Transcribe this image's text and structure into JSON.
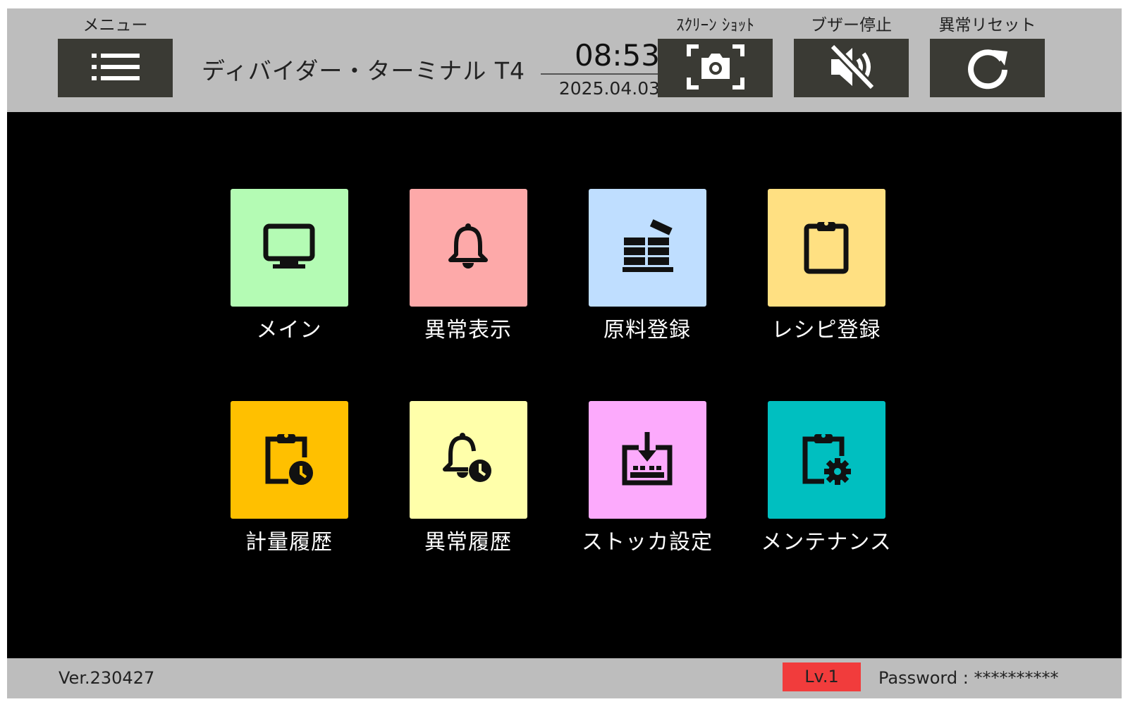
{
  "header": {
    "menu_caption": "メニュー",
    "title": "ディバイダー・ターミナル T4",
    "time": "08:53",
    "date": "2025.04.03",
    "screenshot_caption": "ｽｸﾘｰﾝ ｼｮｯﾄ",
    "buzzer_caption": "ブザー停止",
    "reset_caption": "異常リセット",
    "icons": {
      "menu": "menu-list-icon",
      "screenshot": "camera-icon",
      "buzzer": "speaker-muted-icon",
      "reset": "refresh-icon"
    }
  },
  "tiles": [
    {
      "label": "メイン",
      "color": "#b4fbb4",
      "icon": "monitor-icon"
    },
    {
      "label": "異常表示",
      "color": "#fda9a9",
      "icon": "bell-icon"
    },
    {
      "label": "原料登録",
      "color": "#bfdeff",
      "icon": "stacked-bricks-icon"
    },
    {
      "label": "レシピ登録",
      "color": "#ffe082",
      "icon": "clipboard-icon"
    },
    {
      "label": "計量履歴",
      "color": "#ffc000",
      "icon": "clipboard-clock-icon"
    },
    {
      "label": "異常履歴",
      "color": "#ffffaa",
      "icon": "bell-clock-icon"
    },
    {
      "label": "ストッカ設定",
      "color": "#fcaafc",
      "icon": "tray-download-icon"
    },
    {
      "label": "メンテナンス",
      "color": "#00bfc0",
      "icon": "clipboard-gear-icon"
    }
  ],
  "footer": {
    "version": "Ver.230427",
    "level": "Lv.1",
    "password_label": "Password : **********"
  },
  "colors": {
    "bar": "#bdbdbd",
    "button": "#3a3a34",
    "background": "#000000",
    "level_badge": "#f13c3c"
  }
}
